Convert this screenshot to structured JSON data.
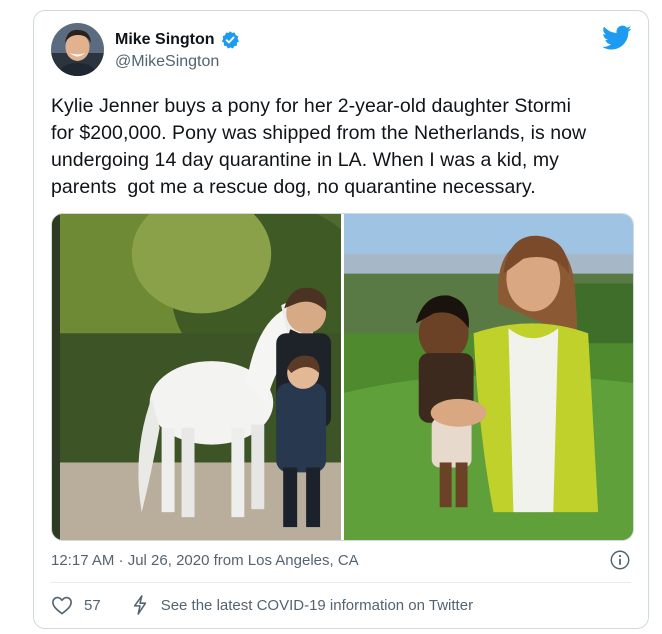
{
  "author": {
    "display_name": "Mike Sington",
    "handle": "@MikeSington",
    "verified": true,
    "avatar_icon": "person-avatar"
  },
  "tweet": {
    "text": "Kylie Jenner buys a pony for her 2-year-old daughter Stormi\nfor $200,000. Pony was shipped from the Netherlands, is now\nundergoing 14 day quarantine in LA. When I was a kid, my\nparents  got me a rescue dog, no quarantine necessary.",
    "timestamp": "12:17 AM · Jul 26, 2020 from Los Angeles, CA"
  },
  "media": {
    "photos": [
      "pony-photo",
      "mother-daughter-photo"
    ]
  },
  "actions": {
    "like_count": "57",
    "covid_link": "See the latest COVID-19 information on Twitter"
  },
  "colors": {
    "brand_blue": "#1d9bf0",
    "text_primary": "#0f1419",
    "text_secondary": "#536471",
    "border": "#cfd9de"
  },
  "icons": {
    "logo": "twitter-bird-icon",
    "verified": "verified-badge-icon",
    "info": "info-icon",
    "like": "heart-icon",
    "covid": "bolt-icon"
  }
}
